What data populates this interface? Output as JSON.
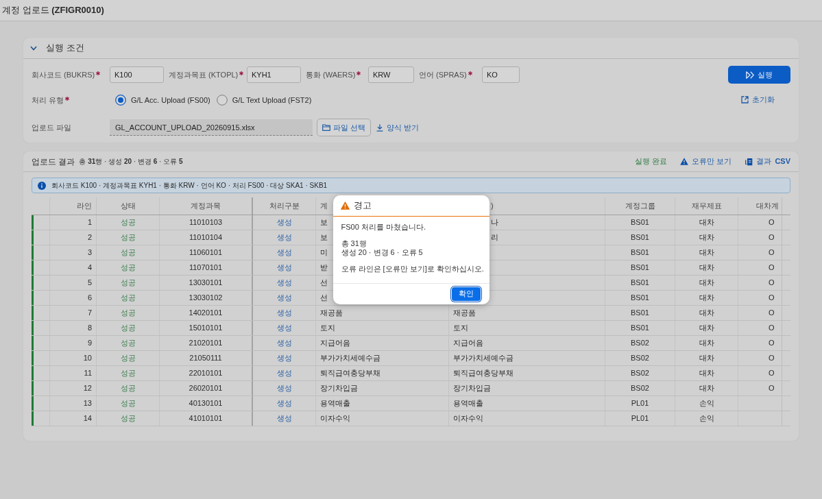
{
  "page": {
    "title": "계정 업로드 **(ZFIGR0010)**"
  },
  "conditions": {
    "title": "실행 조건",
    "expanded": true,
    "fields": [
      {
        "label": "회사코드 (BUKRS)",
        "required": true,
        "value": "K100"
      },
      {
        "label": "계정과목표 (KTOPL)",
        "required": true,
        "value": "KYH1"
      },
      {
        "label": "통화 (WAERS)",
        "required": true,
        "value": "KRW"
      },
      {
        "label": "언어 (SPRAS)",
        "required": true,
        "value": "KO"
      }
    ],
    "processing": {
      "label": "처리 유형",
      "required": true,
      "options": [
        {
          "label": "G/L Acc. Upload (FS00)",
          "selected": true
        },
        {
          "label": "G/L Text Upload (FST2)",
          "selected": false
        }
      ]
    },
    "file": {
      "label": "업로드 파일",
      "value": "GL_ACCOUNT_UPLOAD_20260915.xlsx",
      "browse_button": "파일 선택",
      "template_link": "양식 받기"
    },
    "run_button": "실행",
    "reset_link": "초기화"
  },
  "results": {
    "title": "업로드 결과",
    "summary": "총 **31**행 · 생성 **20** · 변경 **6** · 오류 **5**",
    "status": "실행 완료",
    "errors_only_button": "오류만 보기",
    "csv_button": "결과 **CSV**",
    "info": "회사코드 K100 · 계정과목표 KYH1 · 통화 KRW · 언어 KO · 처리 FS00 · 대상 SKA1 · SKB1",
    "table": {
      "columns": [
        "라인",
        "상태",
        "계정과목",
        "처리구분",
        "계",
        ")",
        "계정그룹",
        "재무제표",
        "대차계"
      ],
      "rows": [
        {
          "color": "#1e7a36",
          "line": "1",
          "status": "성공",
          "account": "11010103",
          "process": "생성",
          "column_5": "보",
          "column_6": "나",
          "group": "BS01",
          "statement": "대차",
          "column_9": "O"
        },
        {
          "color": "#1e7a36",
          "line": "2",
          "status": "성공",
          "account": "11010104",
          "process": "생성",
          "column_5": "보",
          "column_6": "리",
          "group": "BS01",
          "statement": "대차",
          "column_9": "O"
        },
        {
          "color": "#1e7a36",
          "line": "3",
          "status": "성공",
          "account": "11060101",
          "process": "생성",
          "column_5": "미",
          "group": "BS01",
          "statement": "대차",
          "column_9": "O"
        },
        {
          "color": "#1e7a36",
          "line": "4",
          "status": "성공",
          "account": "11070101",
          "process": "생성",
          "column_5": "받",
          "group": "BS01",
          "statement": "대차",
          "column_9": "O"
        },
        {
          "color": "#1e7a36",
          "line": "5",
          "status": "성공",
          "account": "13030101",
          "process": "생성",
          "column_5": "선",
          "group": "BS01",
          "statement": "대차",
          "column_9": "O"
        },
        {
          "color": "#1e7a36",
          "line": "6",
          "status": "성공",
          "account": "13030102",
          "process": "생성",
          "column_5": "선",
          "group": "BS01",
          "statement": "대차",
          "column_9": "O"
        },
        {
          "color": "#1e7a36",
          "line": "7",
          "status": "성공",
          "account": "14020101",
          "process": "생성",
          "column_5": "재공품",
          "column_6": "재공품",
          "group": "BS01",
          "statement": "대차",
          "column_9": "O"
        },
        {
          "color": "#1e7a36",
          "line": "8",
          "status": "성공",
          "account": "15010101",
          "process": "생성",
          "column_5": "토지",
          "column_6": "토지",
          "group": "BS01",
          "statement": "대차",
          "column_9": "O"
        },
        {
          "color": "#1e7a36",
          "line": "9",
          "status": "성공",
          "account": "21020101",
          "process": "생성",
          "column_5": "지급어음",
          "column_6": "지급어음",
          "group": "BS02",
          "statement": "대차",
          "column_9": "O"
        },
        {
          "color": "#1e7a36",
          "line": "10",
          "status": "성공",
          "account": "21050111",
          "process": "생성",
          "column_5": "부가가치세예수금",
          "column_6": "부가가치세예수금",
          "group": "BS02",
          "statement": "대차",
          "column_9": "O"
        },
        {
          "color": "#1e7a36",
          "line": "11",
          "status": "성공",
          "account": "22010101",
          "process": "생성",
          "column_5": "퇴직급여충당부채",
          "column_6": "퇴직급여충당부채",
          "group": "BS02",
          "statement": "대차",
          "column_9": "O"
        },
        {
          "color": "#1e7a36",
          "line": "12",
          "status": "성공",
          "account": "26020101",
          "process": "생성",
          "column_5": "장기차입금",
          "column_6": "장기차입금",
          "group": "BS02",
          "statement": "대차",
          "column_9": "O"
        },
        {
          "color": "#1e7a36",
          "line": "13",
          "status": "성공",
          "account": "40130101",
          "process": "생성",
          "column_5": "용역매출",
          "column_6": "용역매출",
          "group": "PL01",
          "statement": "손익"
        },
        {
          "color": "#1e7a36",
          "line": "14",
          "status": "성공",
          "account": "41010101",
          "process": "생성",
          "column_5": "이자수익",
          "column_6": "이자수익",
          "group": "PL01",
          "statement": "손익"
        }
      ]
    }
  },
  "dialog": {
    "title": "경고",
    "paragraphs": [
      [
        "FS00 처리를 마쳤습니다."
      ],
      [
        "총 31행",
        "생성 20 · 변경 6 · 오류 5"
      ],
      [
        "오류 라인은 [오류만 보기]로 확인하십시오."
      ]
    ],
    "button": "확인"
  }
}
